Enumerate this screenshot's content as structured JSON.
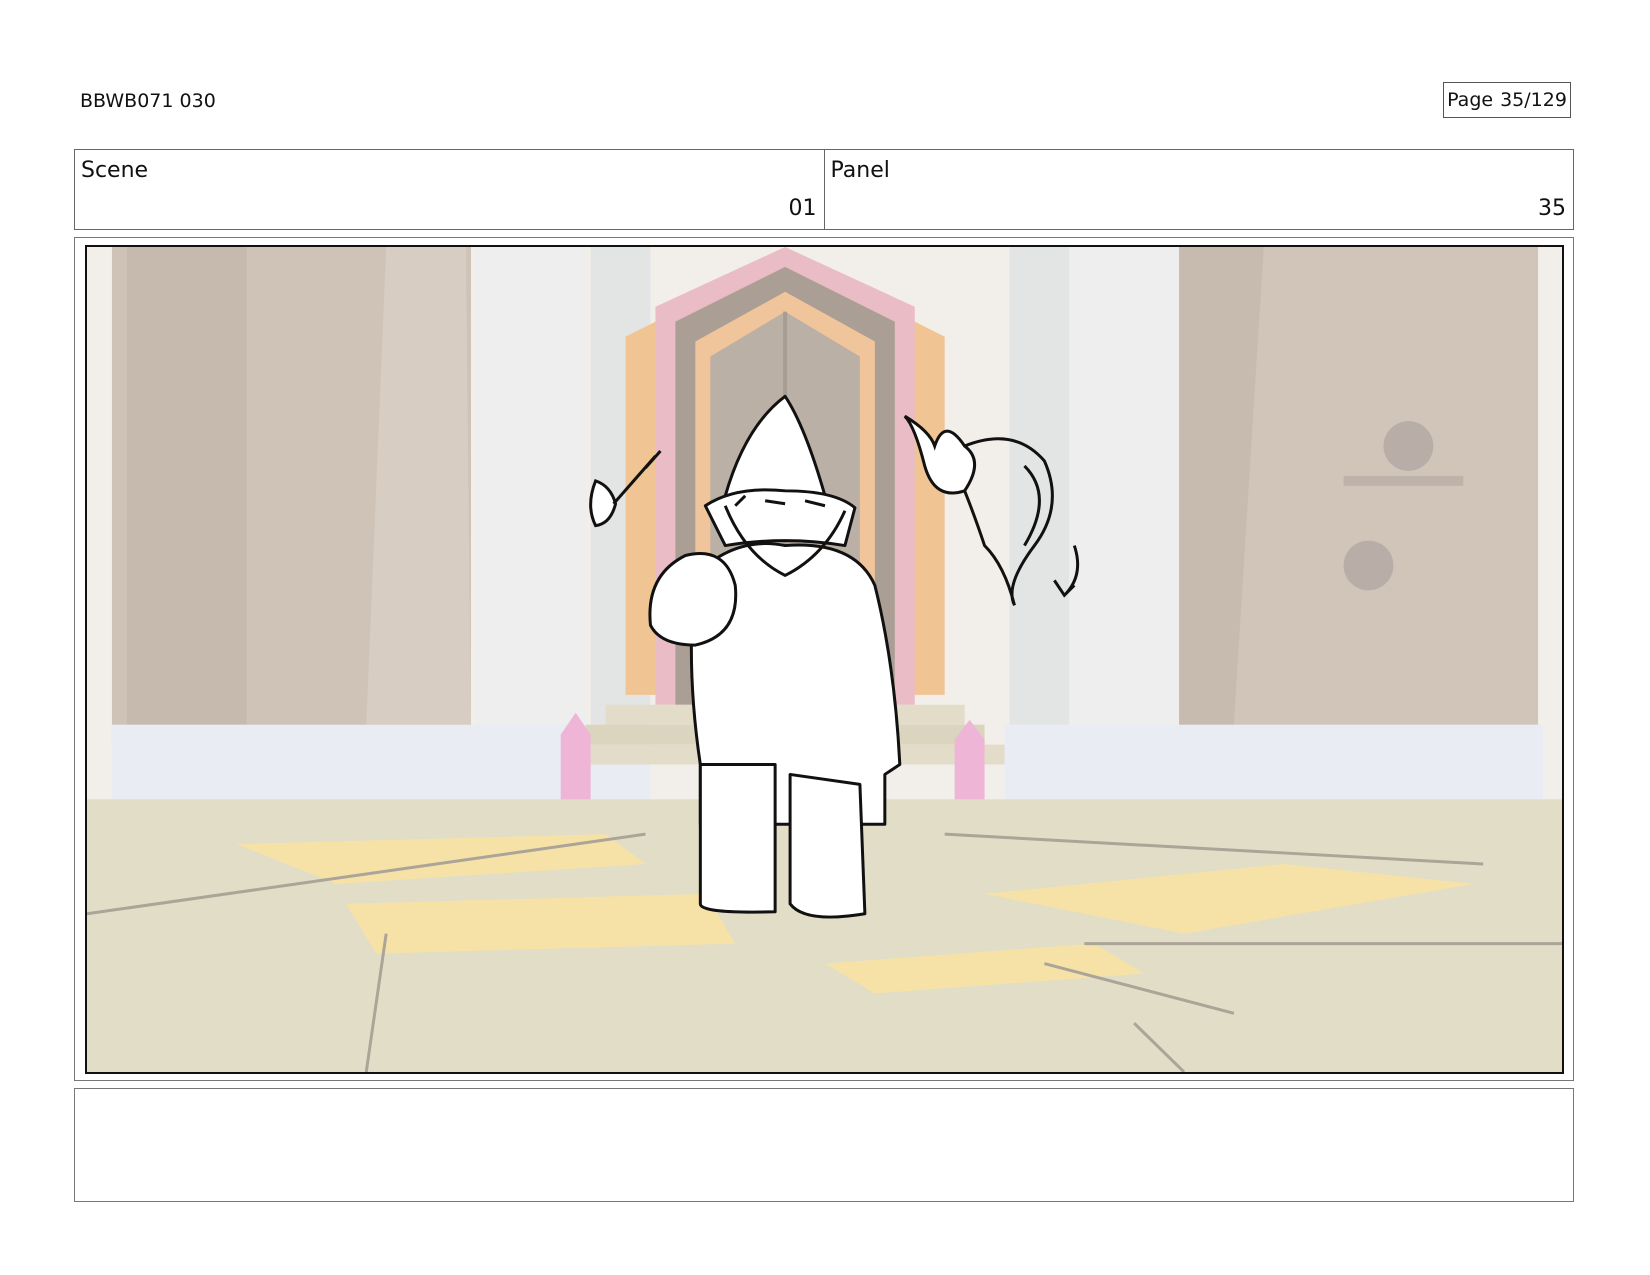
{
  "header": {
    "production_id": "BBWB071 030",
    "page_label": "Page",
    "page_number": "35/129"
  },
  "scene": {
    "label": "Scene",
    "value": "01"
  },
  "panel": {
    "label": "Panel",
    "value": "35"
  },
  "artwork": {
    "description_icon": "storyboard-panel-image",
    "colors": {
      "wall": "#bfae9f",
      "column": "#e4e4e2",
      "floor": "#d8d2b4",
      "floor_patch": "#f3d98a",
      "door_pink": "#e3a6b3",
      "door_orange": "#ebb26f",
      "door_dark": "#8f7f72",
      "crystal": "#e89cc8",
      "ink": "#111111"
    }
  },
  "notes": {
    "text": ""
  }
}
